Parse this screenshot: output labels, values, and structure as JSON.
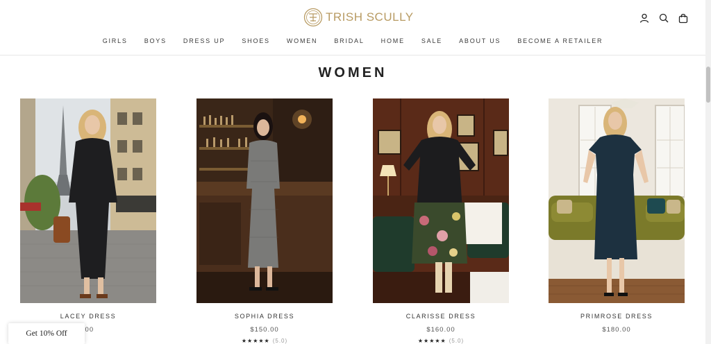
{
  "brand": {
    "name": "TRISH SCULLY",
    "color": "#b89b63"
  },
  "header_icons": [
    "account-icon",
    "search-icon",
    "cart-icon"
  ],
  "nav": [
    "GIRLS",
    "BOYS",
    "DRESS UP",
    "SHOES",
    "WOMEN",
    "BRIDAL",
    "HOME",
    "SALE",
    "ABOUT US",
    "BECOME A RETAILER"
  ],
  "page_title": "WOMEN",
  "products": [
    {
      "name": "LACEY DRESS",
      "price": ".00"
    },
    {
      "name": "SOPHIA DRESS",
      "price": "$150.00",
      "stars": "★★★★★",
      "score": "(5.0)"
    },
    {
      "name": "CLARISSE DRESS",
      "price": "$160.00",
      "stars": "★★★★★",
      "score": "(5.0)"
    },
    {
      "name": "PRIMROSE DRESS",
      "price": "$180.00"
    }
  ],
  "promo": {
    "label": "Get 10% Off"
  }
}
